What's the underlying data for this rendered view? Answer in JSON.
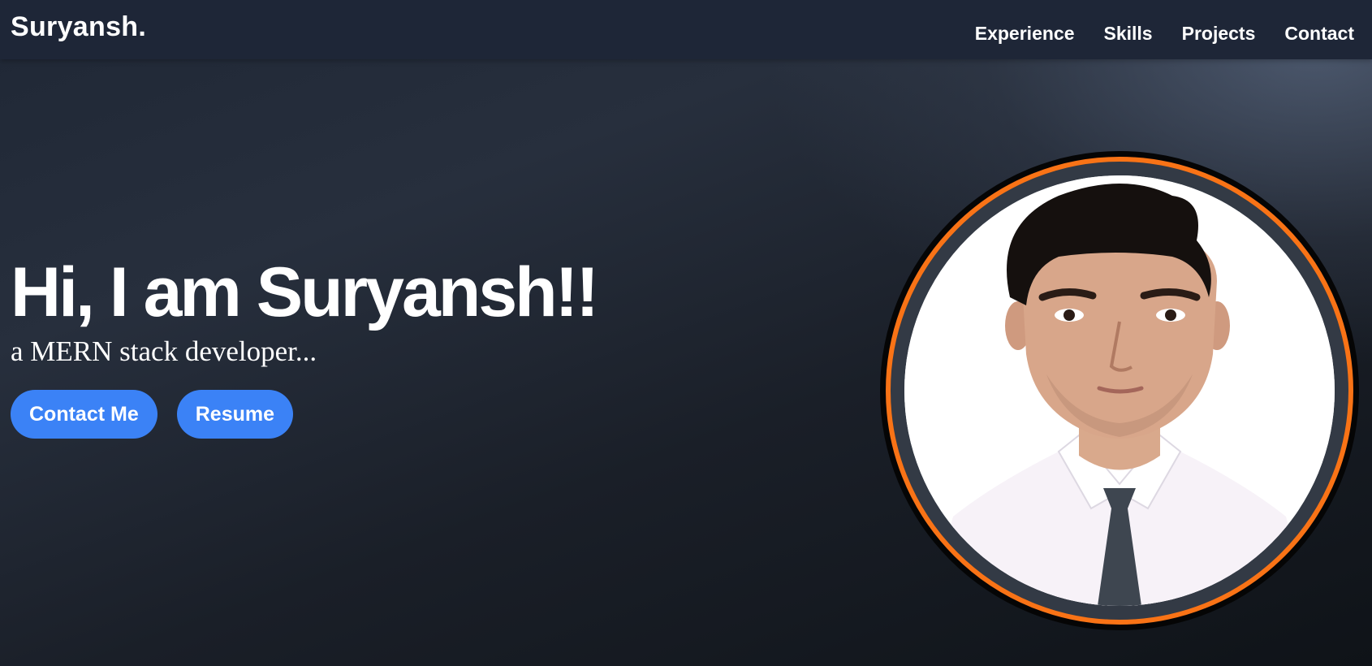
{
  "brand": "Suryansh.",
  "nav": {
    "items": [
      {
        "label": "Experience"
      },
      {
        "label": "Skills"
      },
      {
        "label": "Projects"
      },
      {
        "label": "Contact"
      }
    ]
  },
  "hero": {
    "title": "Hi, I am Suryansh!!",
    "subtitle": "a MERN stack developer...",
    "buttons": {
      "contact": "Contact Me",
      "resume": "Resume"
    }
  },
  "portrait": {
    "icon": "profile-photo",
    "ring_color": "#f97316"
  },
  "colors": {
    "navbar": "#1e2637",
    "button": "#3b82f6",
    "text": "#ffffff"
  }
}
